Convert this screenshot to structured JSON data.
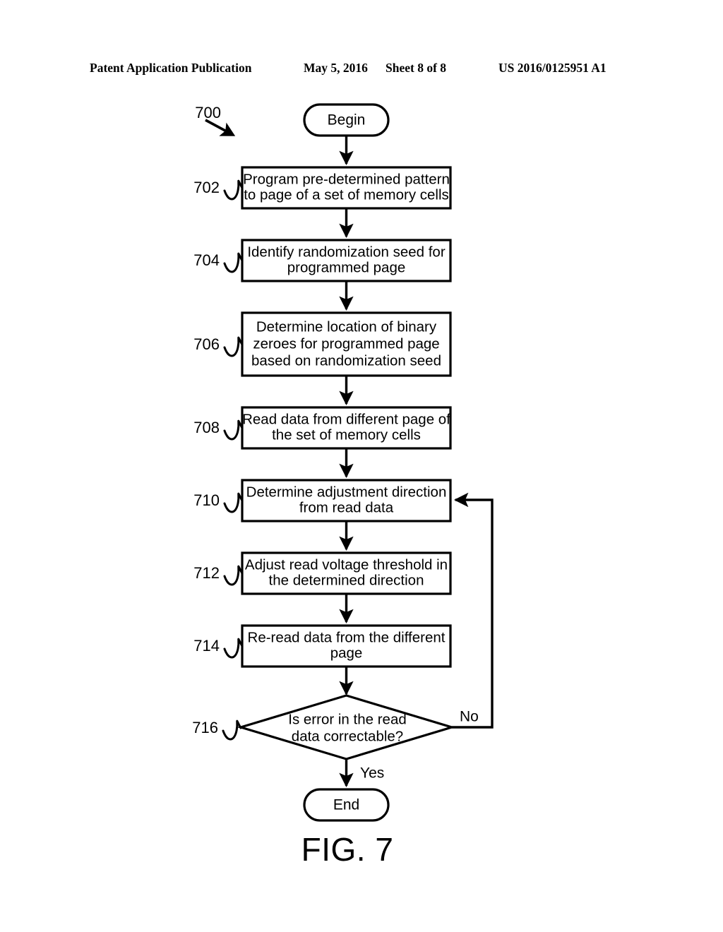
{
  "header": {
    "publication": "Patent Application Publication",
    "date": "May 5, 2016",
    "sheet": "Sheet 8 of 8",
    "patent_number": "US 2016/0125951 A1"
  },
  "figure": {
    "caption": "FIG. 7",
    "diagram_ref": "700"
  },
  "flowchart": {
    "start_label": "Begin",
    "end_label": "End",
    "yes_label": "Yes",
    "no_label": "No",
    "steps": [
      {
        "ref": "702",
        "lines": [
          "Program pre-determined pattern",
          "to page of a set of memory cells"
        ]
      },
      {
        "ref": "704",
        "lines": [
          "Identify randomization seed for",
          "programmed page"
        ]
      },
      {
        "ref": "706",
        "lines": [
          "Determine location of binary",
          "zeroes for programmed page",
          "based on randomization seed"
        ]
      },
      {
        "ref": "708",
        "lines": [
          "Read data from different page of",
          "the set of memory cells"
        ]
      },
      {
        "ref": "710",
        "lines": [
          "Determine adjustment direction",
          "from read data"
        ]
      },
      {
        "ref": "712",
        "lines": [
          "Adjust read voltage threshold in",
          "the determined direction"
        ]
      },
      {
        "ref": "714",
        "lines": [
          "Re-read data from the different",
          "page"
        ]
      }
    ],
    "decision": {
      "ref": "716",
      "lines": [
        "Is error in the read",
        "data  correctable?"
      ]
    }
  },
  "colors": {
    "ink": "#000000",
    "paper": "#ffffff"
  }
}
